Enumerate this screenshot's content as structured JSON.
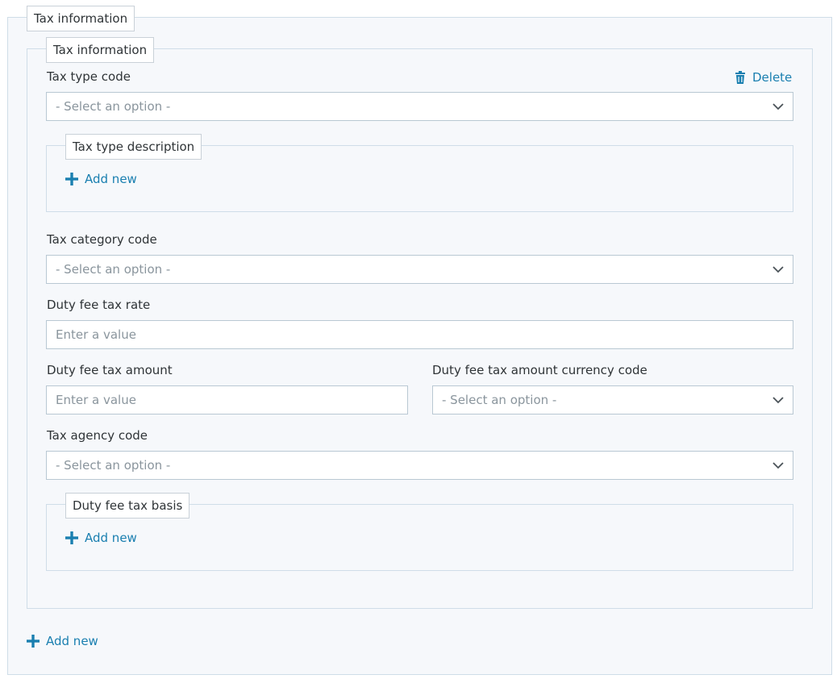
{
  "outer": {
    "legend": "Tax information",
    "add_new": "Add new"
  },
  "inner": {
    "legend": "Tax information",
    "delete": "Delete",
    "tax_type_code": {
      "label": "Tax type code",
      "value": "- Select an option -"
    },
    "tax_type_description": {
      "legend": "Tax type description",
      "add_new": "Add new"
    },
    "tax_category_code": {
      "label": "Tax category code",
      "value": "- Select an option -"
    },
    "duty_fee_tax_rate": {
      "label": "Duty fee tax rate",
      "placeholder": "Enter a value"
    },
    "duty_fee_tax_amount": {
      "label": "Duty fee tax amount",
      "placeholder": "Enter a value"
    },
    "duty_fee_tax_amount_currency_code": {
      "label": "Duty fee tax amount currency code",
      "value": "- Select an option -"
    },
    "tax_agency_code": {
      "label": "Tax agency code",
      "value": "- Select an option -"
    },
    "duty_fee_tax_basis": {
      "legend": "Duty fee tax basis",
      "add_new": "Add new"
    }
  },
  "icons": {
    "delete": "trash-icon",
    "add": "plus-icon",
    "dropdown": "chevron-down-icon"
  },
  "colors": {
    "link": "#1a7fb0",
    "panel_bg": "#f6f8fb",
    "border": "#cfdde8",
    "placeholder": "#8a959d"
  }
}
